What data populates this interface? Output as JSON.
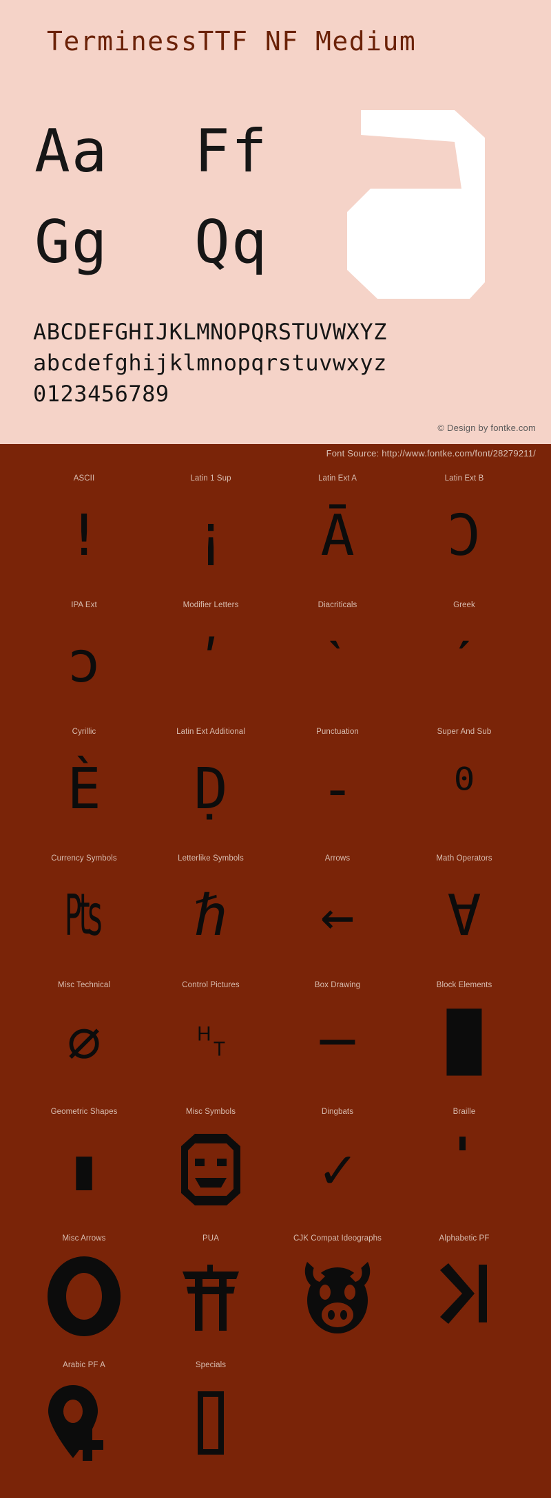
{
  "colors": {
    "top_background": "#f5d3c8",
    "bottom_background": "#7a2408",
    "title_color": "#6b2208",
    "glyph_color": "#161616",
    "label_color": "#d8bdb0",
    "watermark_color": "#ffffff"
  },
  "header": {
    "title": "TerminessTTF NF Medium"
  },
  "watermark": {
    "glyph": "a",
    "icon_name": "letter-a-watermark"
  },
  "samples": {
    "rows": [
      {
        "pairs": [
          "Aa",
          "Ff"
        ]
      },
      {
        "pairs": [
          "Gg",
          "Qq"
        ]
      }
    ],
    "uppercase": "ABCDEFGHIJKLMNOPQRSTUVWXYZ",
    "lowercase": "abcdefghijklmnopqrstuvwxyz",
    "digits": "0123456789"
  },
  "credit": {
    "text": "© Design by fontke.com"
  },
  "source": {
    "text": "Font Source: http://www.fontke.com/font/28279211/"
  },
  "blocks": {
    "rows": [
      [
        {
          "label": "ASCII",
          "glyph": "!",
          "icon_name": "glyph-exclamation-mark"
        },
        {
          "label": "Latin 1 Sup",
          "glyph": "¡",
          "icon_name": "glyph-inverted-exclamation"
        },
        {
          "label": "Latin Ext A",
          "glyph": "Ā",
          "icon_name": "glyph-a-macron"
        },
        {
          "label": "Latin Ext B",
          "glyph": "Ɔ",
          "icon_name": "glyph-open-o"
        }
      ],
      [
        {
          "label": "IPA Ext",
          "glyph": "ɔ",
          "icon_name": "glyph-open-o-small"
        },
        {
          "label": "Modifier Letters",
          "glyph": "ʹ",
          "icon_name": "glyph-modifier-prime"
        },
        {
          "label": "Diacriticals",
          "glyph": "ˋ",
          "icon_name": "glyph-grave-accent"
        },
        {
          "label": "Greek",
          "glyph": "ˊ",
          "icon_name": "glyph-acute-accent"
        }
      ],
      [
        {
          "label": "Cyrillic",
          "glyph": "Ѐ",
          "icon_name": "glyph-ie-grave"
        },
        {
          "label": "Latin Ext Additional",
          "glyph": "Ḍ",
          "icon_name": "glyph-d-dot-below"
        },
        {
          "label": "Punctuation",
          "glyph": "‐",
          "icon_name": "glyph-hyphen"
        },
        {
          "label": "Super And Sub",
          "glyph": "⁰",
          "icon_name": "glyph-superscript-zero"
        }
      ],
      [
        {
          "label": "Currency Symbols",
          "glyph": "₧",
          "icon_name": "glyph-peseta-sign"
        },
        {
          "label": "Letterlike Symbols",
          "glyph": "ℏ",
          "icon_name": "glyph-planck-constant"
        },
        {
          "label": "Arrows",
          "glyph": "←",
          "icon_name": "glyph-left-arrow"
        },
        {
          "label": "Math Operators",
          "glyph": "∀",
          "icon_name": "glyph-for-all"
        }
      ],
      [
        {
          "label": "Misc Technical",
          "glyph": "⌀",
          "icon_name": "glyph-diameter-sign"
        },
        {
          "label": "Control Pictures",
          "glyph": "␉",
          "icon_name": "glyph-control-ht"
        },
        {
          "label": "Box Drawing",
          "glyph": "─",
          "icon_name": "glyph-box-horizontal"
        },
        {
          "label": "Block Elements",
          "glyph": "█",
          "icon_name": "glyph-full-block"
        }
      ],
      [
        {
          "label": "Geometric Shapes",
          "glyph": "▮",
          "icon_name": "glyph-black-vertical-rectangle"
        },
        {
          "label": "Misc Symbols",
          "glyph": "☺",
          "icon_name": "glyph-smiling-face"
        },
        {
          "label": "Dingbats",
          "glyph": "✓",
          "icon_name": "glyph-check-mark"
        },
        {
          "label": "Braille",
          "glyph": "⠁",
          "icon_name": "glyph-braille-dot"
        }
      ],
      [
        {
          "label": "Misc Arrows",
          "glyph": "⭕",
          "icon_name": "glyph-heavy-circle"
        },
        {
          "label": "PUA",
          "glyph": "⛩",
          "icon_name": "glyph-shinto-shrine"
        },
        {
          "label": "CJK Compat Ideographs",
          "glyph": "🐷",
          "icon_name": "glyph-pig-face"
        },
        {
          "label": "Alphabetic PF",
          "glyph": "⏭",
          "icon_name": "glyph-next-track"
        }
      ],
      [
        {
          "label": "Arabic PF A",
          "glyph": "📍",
          "icon_name": "glyph-map-pin-plus"
        },
        {
          "label": "Specials",
          "glyph": "▯",
          "icon_name": "glyph-tofu-box"
        },
        {
          "label": "",
          "glyph": "",
          "icon_name": "glyph-empty"
        },
        {
          "label": "",
          "glyph": "",
          "icon_name": "glyph-empty"
        }
      ]
    ]
  }
}
